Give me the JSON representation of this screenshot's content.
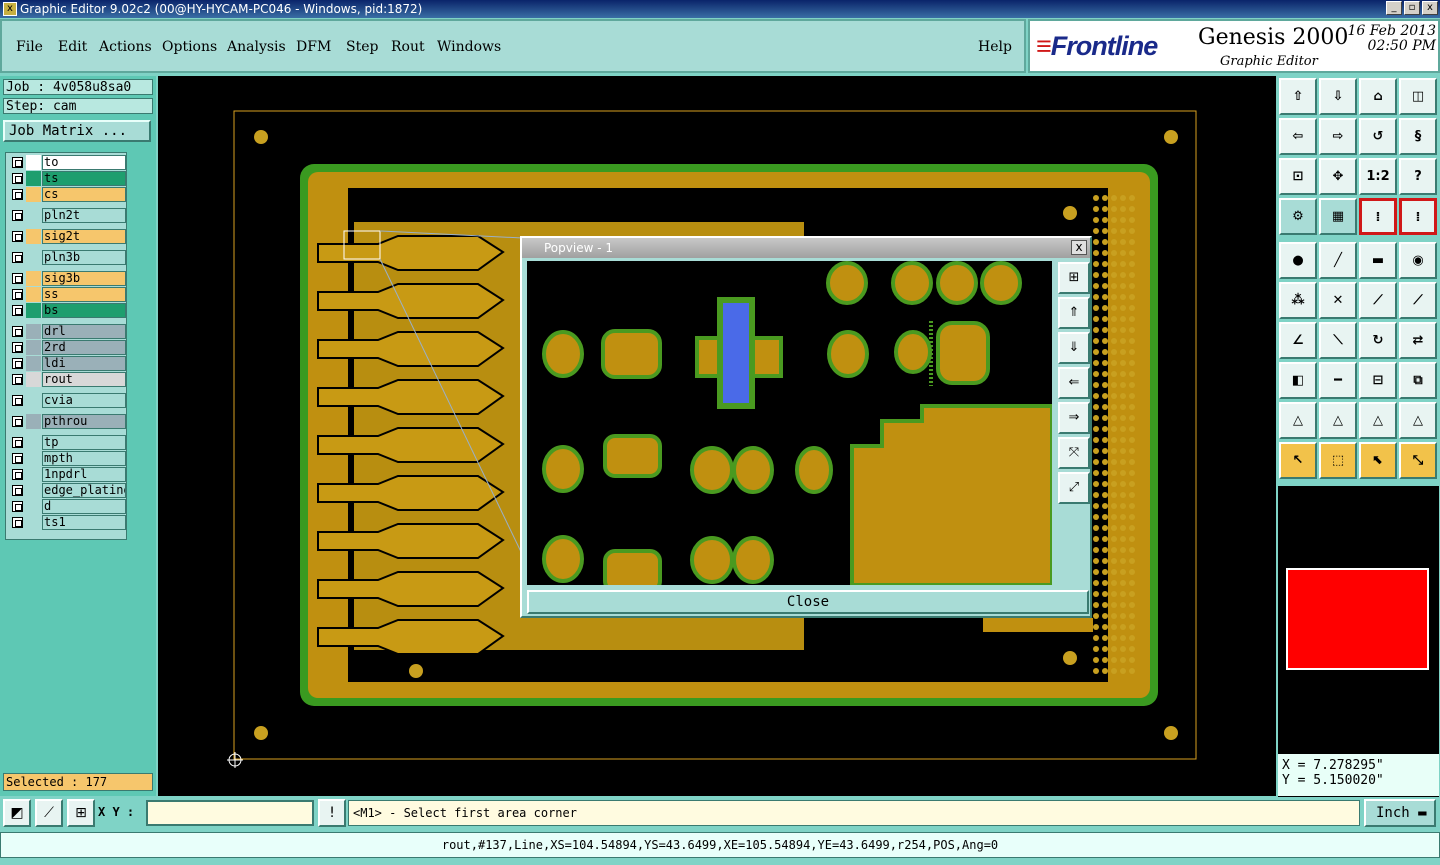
{
  "window": {
    "title": "Graphic Editor 9.02c2 (00@HY-HYCAM-PC046 - Windows, pid:1872)",
    "min": "_",
    "max": "▫",
    "close": "x"
  },
  "menu": [
    "File",
    "Edit",
    "Actions",
    "Options",
    "Analysis",
    "DFM",
    "Step",
    "Rout",
    "Windows"
  ],
  "help": "Help",
  "brand": {
    "logo": "Frontline",
    "product": "Genesis 2000",
    "subtitle": "Graphic Editor",
    "date": "16 Feb 2013",
    "time": "02:50 PM"
  },
  "job": {
    "job_line": "Job : 4v058u8sa0",
    "step_line": "Step: cam",
    "matrix_button": "Job Matrix ..."
  },
  "layers": [
    {
      "name": "to",
      "color": "#ffffff"
    },
    {
      "name": "ts",
      "color": "#1e9e6e"
    },
    {
      "name": "cs",
      "color": "#f6c66c"
    },
    {
      "name": "pln2t",
      "color": "#a8dcd6"
    },
    {
      "name": "sig2t",
      "color": "#f6c66c"
    },
    {
      "name": "pln3b",
      "color": "#a8dcd6"
    },
    {
      "name": "sig3b",
      "color": "#f6c66c"
    },
    {
      "name": "ss",
      "color": "#f6c66c"
    },
    {
      "name": "bs",
      "color": "#1e9e6e"
    },
    {
      "name": "drl",
      "color": "#9ab0b8"
    },
    {
      "name": "2rd",
      "color": "#9ab0b8"
    },
    {
      "name": "ldi",
      "color": "#9ab0b8"
    },
    {
      "name": "rout",
      "color": "#d8d8d8"
    },
    {
      "name": "cvia",
      "color": "#a8dcd6"
    },
    {
      "name": "pthrou",
      "color": "#9ab0b8"
    },
    {
      "name": "tp",
      "color": "#a8dcd6"
    },
    {
      "name": "mpth",
      "color": "#a8dcd6"
    },
    {
      "name": "1npdrl",
      "color": "#a8dcd6"
    },
    {
      "name": "edge_plating",
      "color": "#a8dcd6"
    },
    {
      "name": "d",
      "color": "#a8dcd6"
    },
    {
      "name": "ts1",
      "color": "#a8dcd6"
    }
  ],
  "selected": "Selected : 177",
  "coords": {
    "x": "X = 7.278295\"",
    "y": "Y = 5.150020\""
  },
  "xy_label": "X Y :",
  "xy_value": "",
  "prompt": "<M1> - Select first area corner",
  "units": "Inch",
  "status": "rout,#137,Line,XS=104.54894,YS=43.6499,XE=105.54894,YE=43.6499,r254,POS,Ang=0",
  "popup": {
    "title": "Popview - 1",
    "close_x": "x",
    "close_button": "Close"
  },
  "toolbar_labels": {
    "r4c3": "1:2",
    "r4c4": "?"
  }
}
